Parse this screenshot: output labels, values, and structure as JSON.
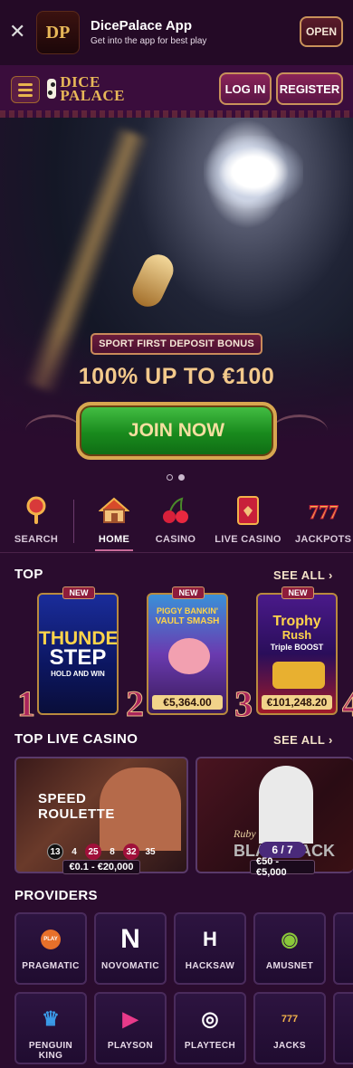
{
  "app_banner": {
    "close": "✕",
    "logo_text": "DP",
    "title": "DicePalace App",
    "subtitle": "Get into the app for best play",
    "open_label": "OPEN"
  },
  "header": {
    "brand_line1": "DICE",
    "brand_line2": "PALACE",
    "login_label": "LOG IN",
    "register_label": "REGISTER"
  },
  "hero": {
    "tag": "SPORT FIRST DEPOSIT BONUS",
    "title": "100% UP TO €100",
    "cta": "JOIN NOW",
    "slides": 2,
    "active_slide": 1
  },
  "categories": [
    {
      "label": "SEARCH",
      "icon": "magnifier-icon"
    },
    {
      "label": "HOME",
      "icon": "house-icon"
    },
    {
      "label": "CASINO",
      "icon": "cherries-icon"
    },
    {
      "label": "LIVE CASINO",
      "icon": "card-icon"
    },
    {
      "label": "JACKPOTS",
      "icon": "777-icon"
    }
  ],
  "top": {
    "title": "TOP",
    "see_all": "SEE ALL",
    "games": [
      {
        "rank": "1",
        "badge": "NEW",
        "name1": "THUNDER",
        "name2": "STEP",
        "name3": "HOLD AND WIN",
        "price": ""
      },
      {
        "rank": "2",
        "badge": "NEW",
        "name1": "PIGGY BANKIN'",
        "name2": "VAULT SMASH",
        "name3": "",
        "price": "€5,364.00"
      },
      {
        "rank": "3",
        "badge": "NEW",
        "name1": "Trophy",
        "name2": "Rush",
        "name3": "Triple BOOST",
        "price": "€101,248.20"
      }
    ],
    "rank4": "4"
  },
  "live": {
    "title": "TOP LIVE CASINO",
    "see_all": "SEE ALL",
    "tables": [
      {
        "name1": "SPEED",
        "name2": "ROULETTE",
        "numbers": [
          "13",
          "4",
          "25",
          "8",
          "32",
          "35"
        ],
        "limit": "€0.1 - €20,000"
      },
      {
        "name1": "Ruby",
        "name2": "BLACKJACK",
        "seats": "6 / 7",
        "limit": "€50 - €5,000"
      }
    ]
  },
  "providers": {
    "title": "PROVIDERS",
    "items": [
      {
        "label": "PRAGMATIC",
        "glyph": "PLAY"
      },
      {
        "label": "NOVOMATIC",
        "glyph": "N"
      },
      {
        "label": "HACKSAW",
        "glyph": "H"
      },
      {
        "label": "AMUSNET",
        "glyph": "◉"
      },
      {
        "label": "PENGUIN KING",
        "glyph": "♛"
      },
      {
        "label": "PLAYSON",
        "glyph": "▶"
      },
      {
        "label": "PLAYTECH",
        "glyph": "◎"
      },
      {
        "label": "JACKS",
        "glyph": "777"
      }
    ]
  },
  "colors": {
    "background": "#2a0c2e",
    "accent_gold": "#e7b758",
    "cta_green": "#198a1d"
  }
}
